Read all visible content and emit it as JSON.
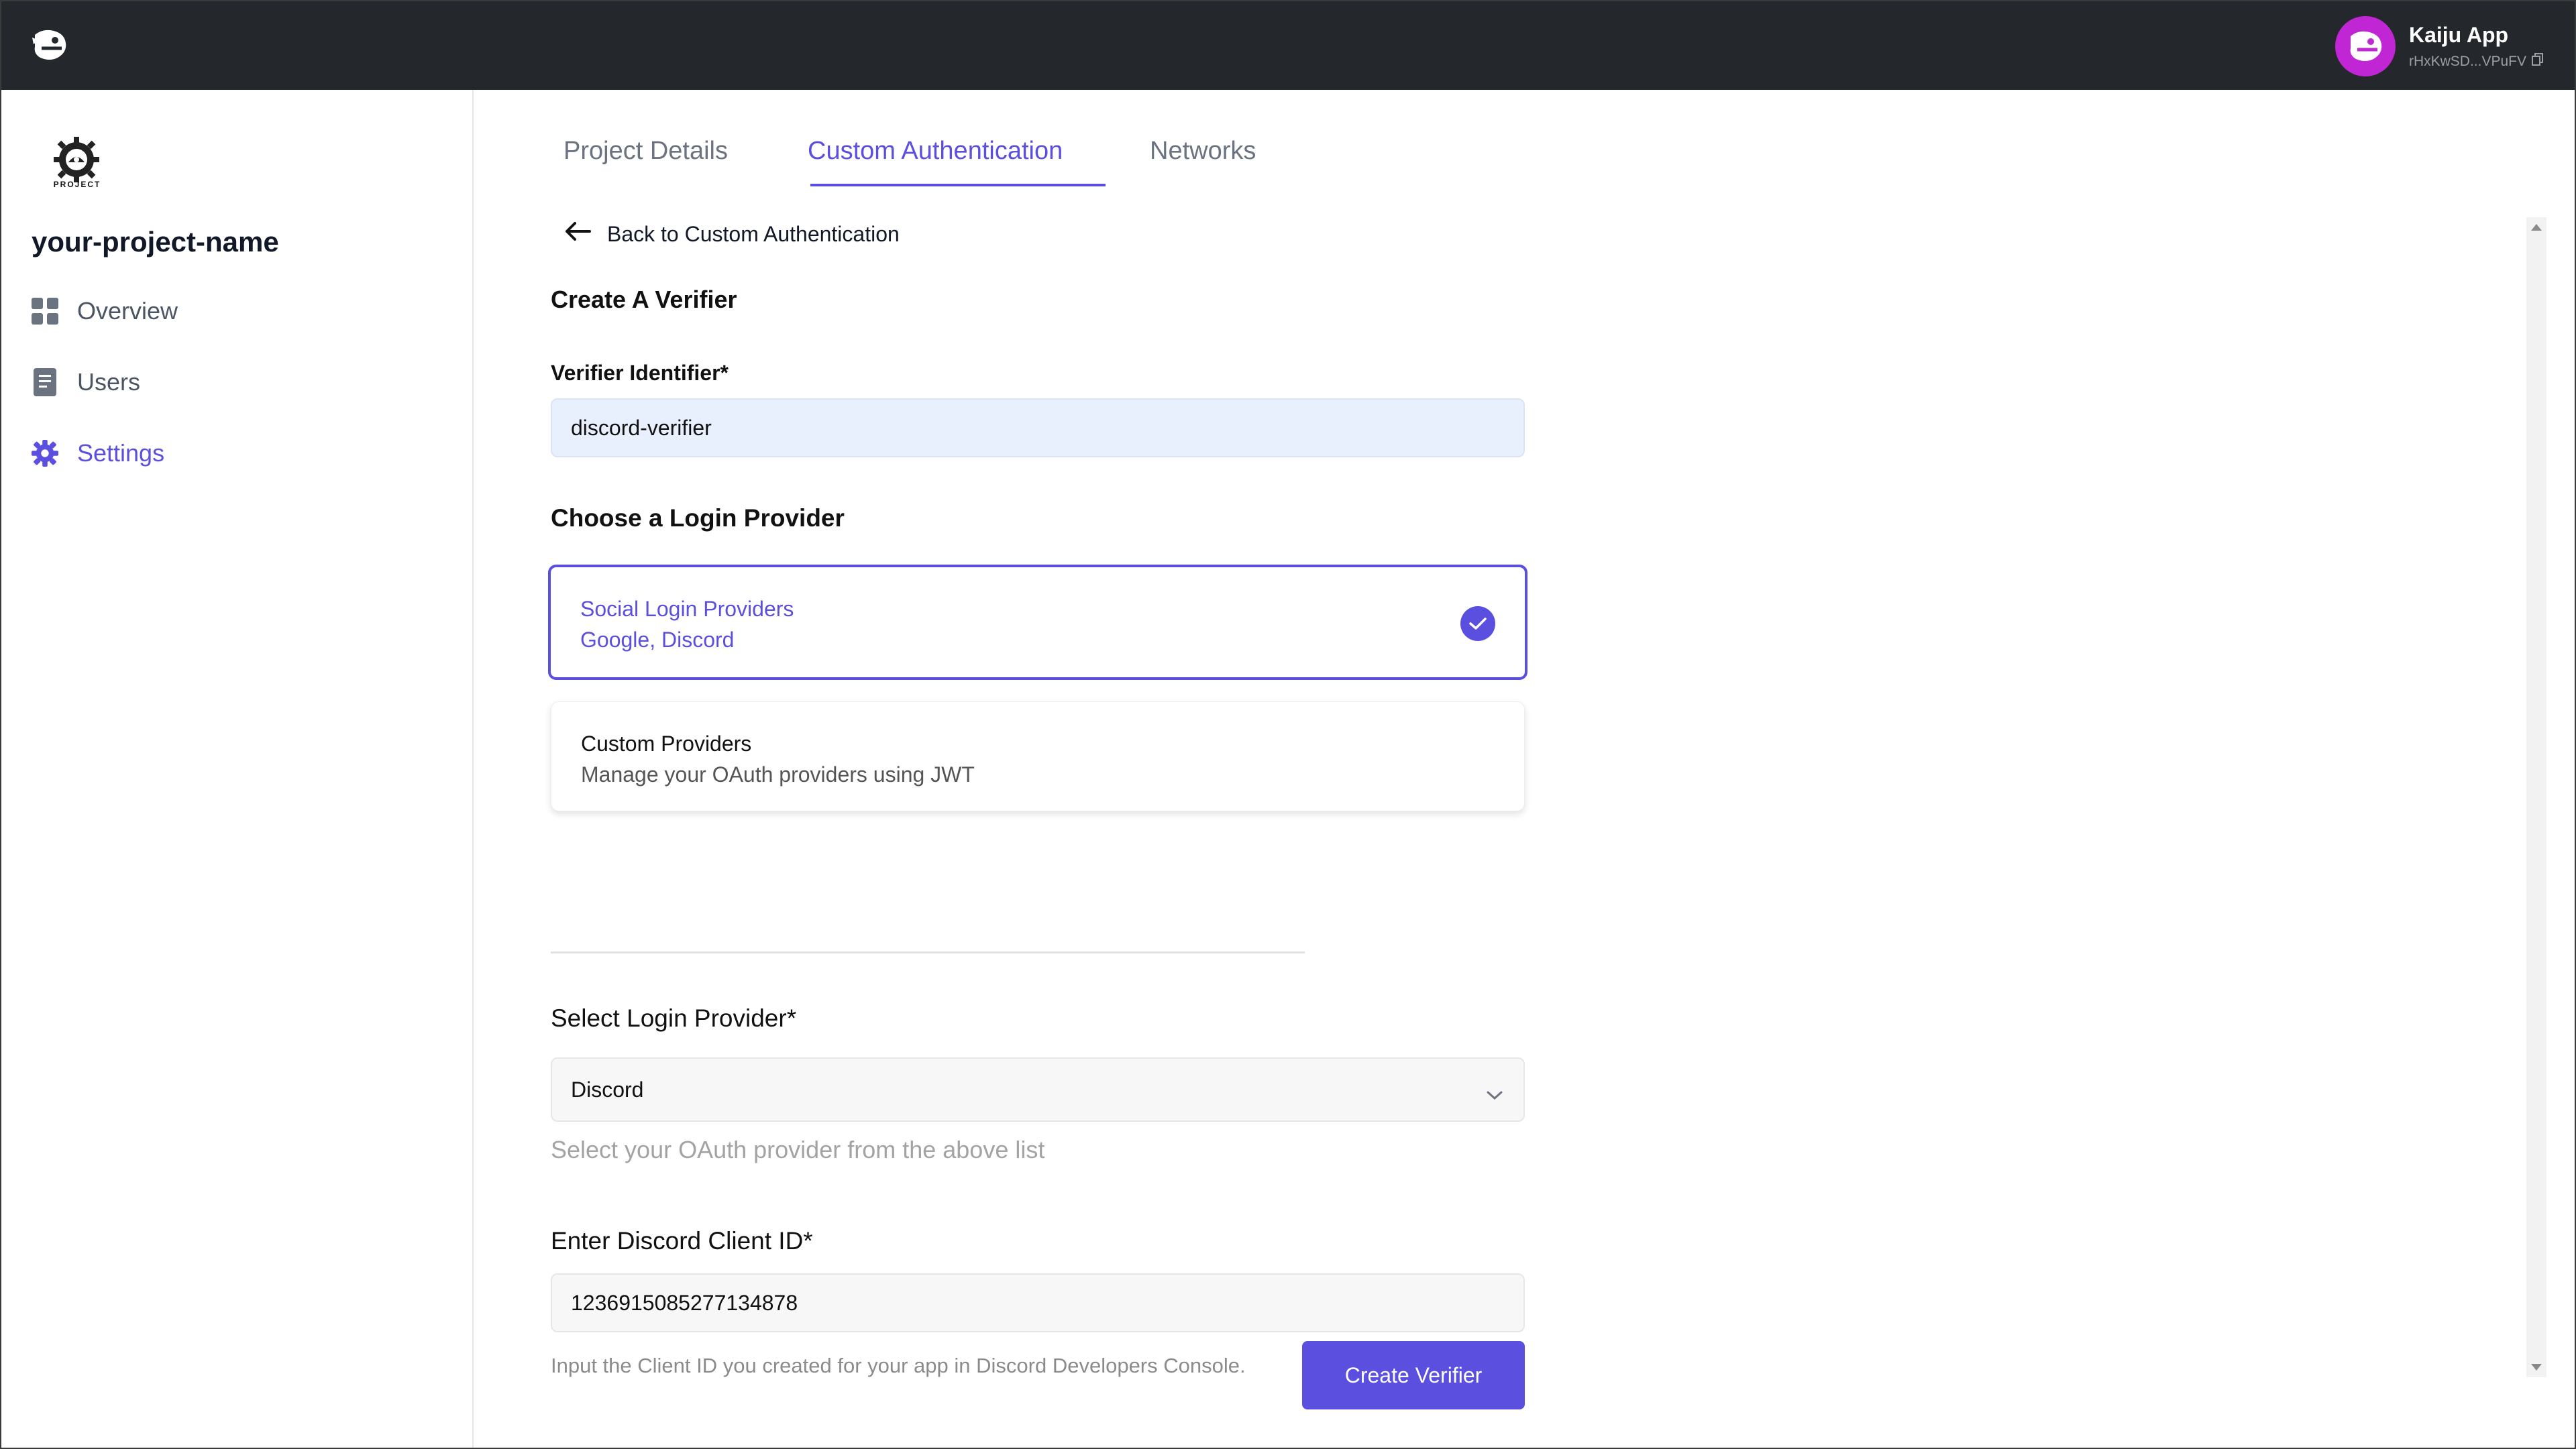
{
  "topbar": {
    "logo_icon": "kaiju-logo-icon",
    "account_name": "Kaiju App",
    "account_address": "rHxKwSD...VPuFV",
    "copy_icon": "copy-icon"
  },
  "sidebar": {
    "project_logo_caption": "PROJECT",
    "project_name": "your-project-name",
    "items": [
      {
        "label": "Overview",
        "icon": "grid-icon",
        "active": false
      },
      {
        "label": "Users",
        "icon": "document-icon",
        "active": false
      },
      {
        "label": "Settings",
        "icon": "gear-icon",
        "active": true
      }
    ]
  },
  "tabs": [
    {
      "label": "Project Details",
      "active": false
    },
    {
      "label": "Custom Authentication",
      "active": true
    },
    {
      "label": "Networks",
      "active": false
    }
  ],
  "form": {
    "back_label": "Back to Custom Authentication",
    "heading": "Create A Verifier",
    "verifier_label": "Verifier Identifier*",
    "verifier_value": "discord-verifier",
    "choose_heading": "Choose a Login Provider",
    "providers": [
      {
        "title": "Social Login Providers",
        "subtitle": "Google, Discord",
        "selected": true
      },
      {
        "title": "Custom Providers",
        "subtitle": "Manage your OAuth providers using JWT",
        "selected": false
      }
    ],
    "select_label": "Select Login Provider*",
    "select_value": "Discord",
    "select_hint": "Select your OAuth provider from the above list",
    "client_label": "Enter Discord Client ID*",
    "client_value": "1236915085277134878",
    "client_hint": "Input the Client ID you created for your app in Discord Developers Console.",
    "submit_label": "Create Verifier"
  },
  "colors": {
    "accent": "#5b4fe0",
    "topbar": "#24272b",
    "avatar": "#c026d3"
  }
}
